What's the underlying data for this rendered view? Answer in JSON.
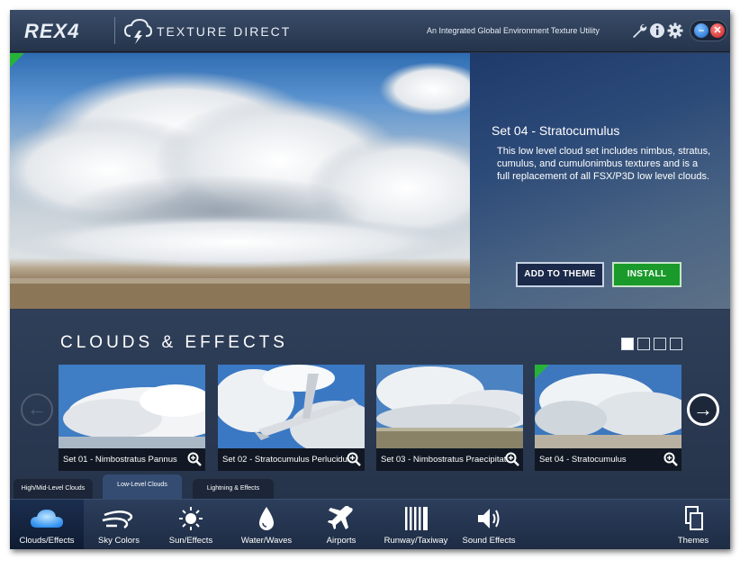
{
  "header": {
    "logo_text": "REX4",
    "product_title": "TEXTURE DIRECT",
    "tagline": "An Integrated Global Environment Texture Utility",
    "icons": [
      "wrench-icon",
      "info-icon",
      "gear-icon"
    ],
    "minimize_icon": "minimize-icon",
    "close_icon": "close-icon"
  },
  "hero": {
    "title": "Set 04 - Stratocumulus",
    "description": "This low level cloud set includes nimbus, stratus, cumulus, and cumulonimbus textures and is a full replacement of all FSX/P3D low level clouds.",
    "add_button": "ADD TO THEME",
    "install_button": "INSTALL"
  },
  "gallery": {
    "section_title": "CLOUDS & EFFECTS",
    "pager_count": 4,
    "pager_active": 1,
    "cards": [
      {
        "label": "Set 01 - Nimbostratus Pannus"
      },
      {
        "label": "Set 02 - Stratocumulus Perlucidus"
      },
      {
        "label": "Set 03 - Nimbostratus Praecipitatio"
      },
      {
        "label": "Set 04 - Stratocumulus"
      }
    ]
  },
  "subtabs": [
    {
      "label": "High/Mid-Level Clouds"
    },
    {
      "label": "Low-Level Clouds"
    },
    {
      "label": "Lightning & Effects"
    }
  ],
  "nav": [
    {
      "label": "Clouds/Effects",
      "icon": "cloud-icon"
    },
    {
      "label": "Sky Colors",
      "icon": "wind-icon"
    },
    {
      "label": "Sun/Effects",
      "icon": "sun-icon"
    },
    {
      "label": "Water/Waves",
      "icon": "water-drop-icon"
    },
    {
      "label": "Airports",
      "icon": "airplane-icon"
    },
    {
      "label": "Runway/Taxiway",
      "icon": "runway-icon"
    },
    {
      "label": "Sound Effects",
      "icon": "speaker-icon"
    },
    {
      "label": "Themes",
      "icon": "themes-icon"
    }
  ],
  "colors": {
    "accent_green": "#1a9a2a",
    "selected_tab": "#344c72",
    "panel_blue": "#2c4a78"
  }
}
